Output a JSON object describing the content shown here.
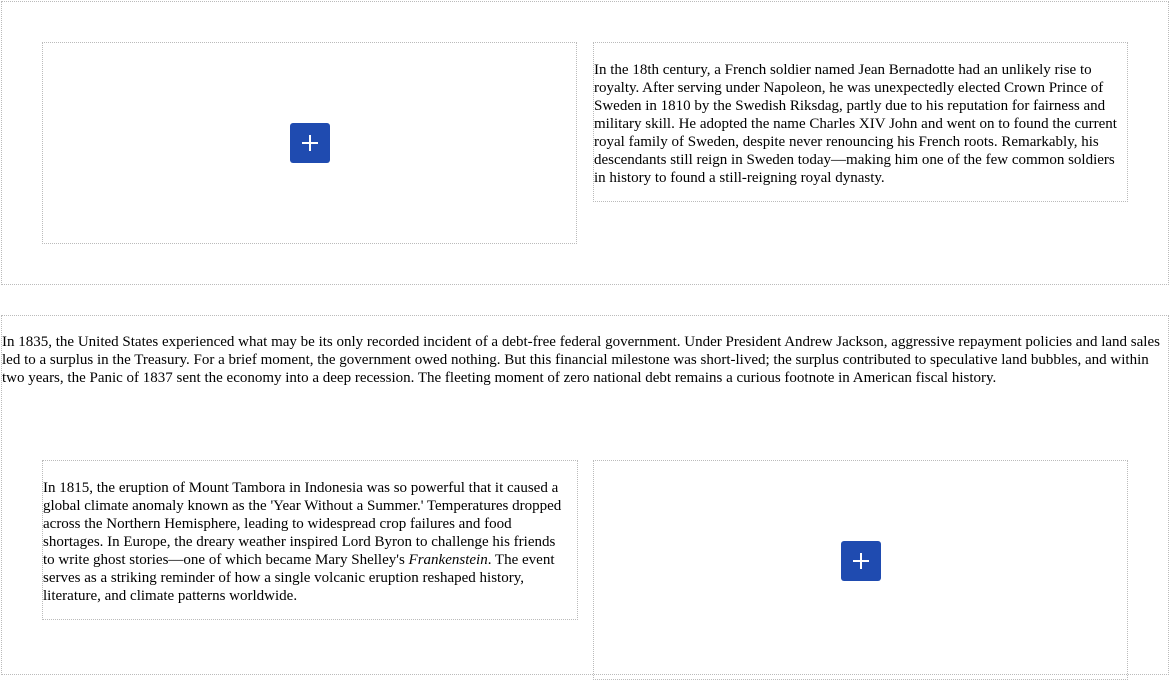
{
  "section1": {
    "add_button_icon": "plus-icon",
    "text": "In the 18th century, a French soldier named Jean Bernadotte had an unlikely rise to royalty. After serving under Napoleon, he was unexpectedly elected Crown Prince of Sweden in 1810 by the Swedish Riksdag, partly due to his reputation for fairness and military skill. He adopted the name Charles XIV John and went on to found the current royal family of Sweden, despite never renouncing his French roots. Remarkably, his descendants still reign in Sweden today—making him one of the few common soldiers in history to found a still-reigning royal dynasty."
  },
  "section2": {
    "text": "In 1835, the United States experienced what may be its only recorded incident of a debt-free federal government. Under President Andrew Jackson, aggressive repayment policies and land sales led to a surplus in the Treasury. For a brief moment, the government owed nothing. But this financial milestone was short-lived; the surplus contributed to speculative land bubbles, and within two years, the Panic of 1837 sent the economy into a deep recession. The fleeting moment of zero national debt remains a curious footnote in American fiscal history.",
    "card_text_before": "In 1815, the eruption of Mount Tambora in Indonesia was so powerful that it caused a global climate anomaly known as the 'Year Without a Summer.' Temperatures dropped across the Northern Hemisphere, leading to widespread crop failures and food shortages. In Europe, the dreary weather inspired Lord Byron to challenge his friends to write ghost stories—one of which became Mary Shelley's ",
    "card_text_italic": "Frankenstein",
    "card_text_after": ". The event serves as a striking reminder of how a single volcanic eruption reshaped history, literature, and climate patterns worldwide.",
    "add_button_icon": "plus-icon"
  },
  "colors": {
    "button": "#1f4bb0",
    "border": "#bbbbbb"
  }
}
